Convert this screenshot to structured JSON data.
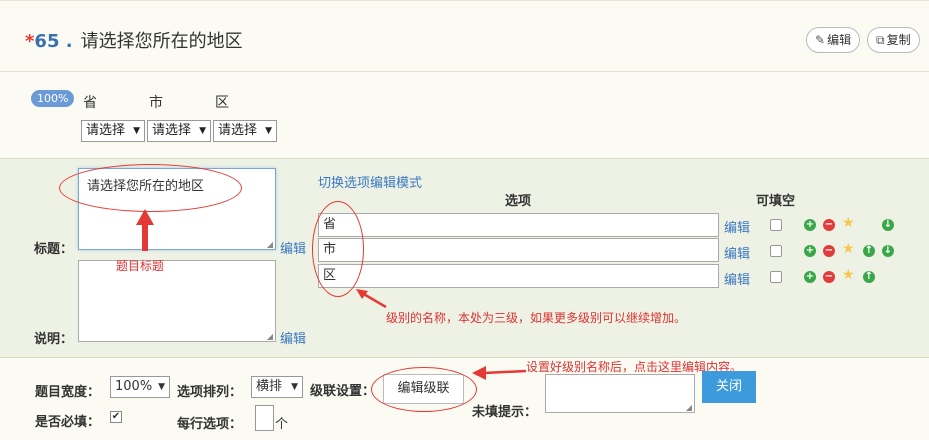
{
  "question": {
    "required_mark": "*",
    "number": "65 .",
    "title": "请选择您所在的地区"
  },
  "toolbar": {
    "edit_label": "编辑",
    "copy_label": "复制",
    "edit_icon": "pencil-icon",
    "copy_icon": "copy-icon"
  },
  "preview": {
    "progress_badge": "100%",
    "levels": [
      "省",
      "市",
      "区"
    ],
    "selects": [
      "请选择",
      "请选择",
      "请选择"
    ]
  },
  "editor": {
    "title_label": "标题：",
    "title_value": "请选择您所在的地区",
    "desc_label": "说明：",
    "edit_link": "编辑",
    "switch_mode_link": "切换选项编辑模式",
    "col_option": "选项",
    "col_fillable": "可填空",
    "options": [
      {
        "value": "省",
        "edit": "编辑"
      },
      {
        "value": "市",
        "edit": "编辑"
      },
      {
        "value": "区",
        "edit": "编辑"
      }
    ]
  },
  "annotations": {
    "title_note": "题目标题",
    "level_note": "级别的名称，本处为三级，如果更多级别可以继续增加。",
    "cascade_note": "设置好级别名称后，点击这里编辑内容。"
  },
  "settings": {
    "width_label": "题目宽度：",
    "width_value": "100%",
    "arrange_label": "选项排列：",
    "arrange_value": "横排",
    "cascade_label": "级联设置：",
    "cascade_button": "编辑级联",
    "required_label": "是否必填：",
    "per_row_label": "每行选项：",
    "per_row_unit": "个",
    "hint_label": "未填提示：",
    "close_button": "关闭"
  },
  "colors": {
    "accent": "#3a78c3",
    "annotation": "#e53935",
    "close_button": "#3d9bdc"
  }
}
